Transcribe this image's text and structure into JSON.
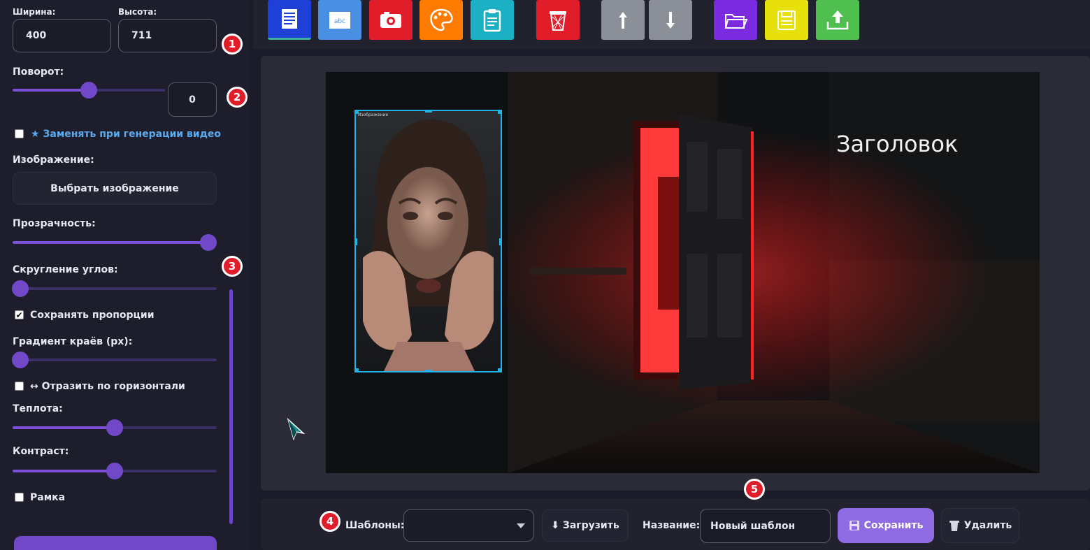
{
  "sidebar": {
    "width_label": "Ширина:",
    "height_label": "Высота:",
    "width_value": "400",
    "height_value": "711",
    "rotation_label": "Поворот:",
    "rotation_value": "0",
    "rotation_level": 0.5,
    "replace_checkbox_label": "★ Заменять при генерации видео",
    "replace_checked": false,
    "image_label": "Изображение:",
    "choose_image_button": "Выбрать изображение",
    "opacity_label": "Прозрачность:",
    "opacity_level": 1.0,
    "corner_radius_label": "Скругление углов:",
    "corner_radius_level": 0.0,
    "keep_proportions_label": "Сохранять пропорции",
    "keep_proportions_checked": true,
    "edge_gradient_label": "Градиент краёв (px):",
    "edge_gradient_level": 0.0,
    "flip_label": "↔ Отразить по горизонтали",
    "flip_checked": false,
    "warmth_label": "Теплота:",
    "warmth_level": 0.5,
    "contrast_label": "Контраст:",
    "contrast_level": 0.5,
    "frame_label": "Рамка",
    "frame_checked": false
  },
  "toolbar": {
    "buttons": [
      {
        "name": "document-icon",
        "color": "#1e3fd8"
      },
      {
        "name": "text-abc-icon",
        "color": "#4a90e2"
      },
      {
        "name": "camera-icon",
        "color": "#e11d2a"
      },
      {
        "name": "palette-icon",
        "color": "#ff7a00"
      },
      {
        "name": "clipboard-icon",
        "color": "#1bb0c4"
      },
      {
        "name": "trash-icon",
        "color": "#e11d2a"
      },
      {
        "name": "arrow-up-icon",
        "color": "#8a8f98"
      },
      {
        "name": "arrow-down-icon",
        "color": "#8a8f98"
      },
      {
        "name": "folder-open-icon",
        "color": "#7a2be0"
      },
      {
        "name": "floppy-save-icon",
        "color": "#e7e00b"
      },
      {
        "name": "upload-tray-icon",
        "color": "#4fbf4f"
      }
    ]
  },
  "canvas": {
    "heading_text": "Заголовок",
    "selected_image_label": "Изображение"
  },
  "bottom": {
    "templates_label": "Шаблоны:",
    "templates_value": "",
    "load_button": "⬇ Загрузить",
    "name_label": "Название:",
    "name_value": "Новый шаблон",
    "save_button": "Сохранить",
    "delete_button": "Удалить"
  },
  "badges": [
    "1",
    "2",
    "3",
    "4",
    "5"
  ],
  "colors": {
    "accent": "#7048c8",
    "badge_red": "#e11d2a",
    "selection": "#22b3e6"
  }
}
